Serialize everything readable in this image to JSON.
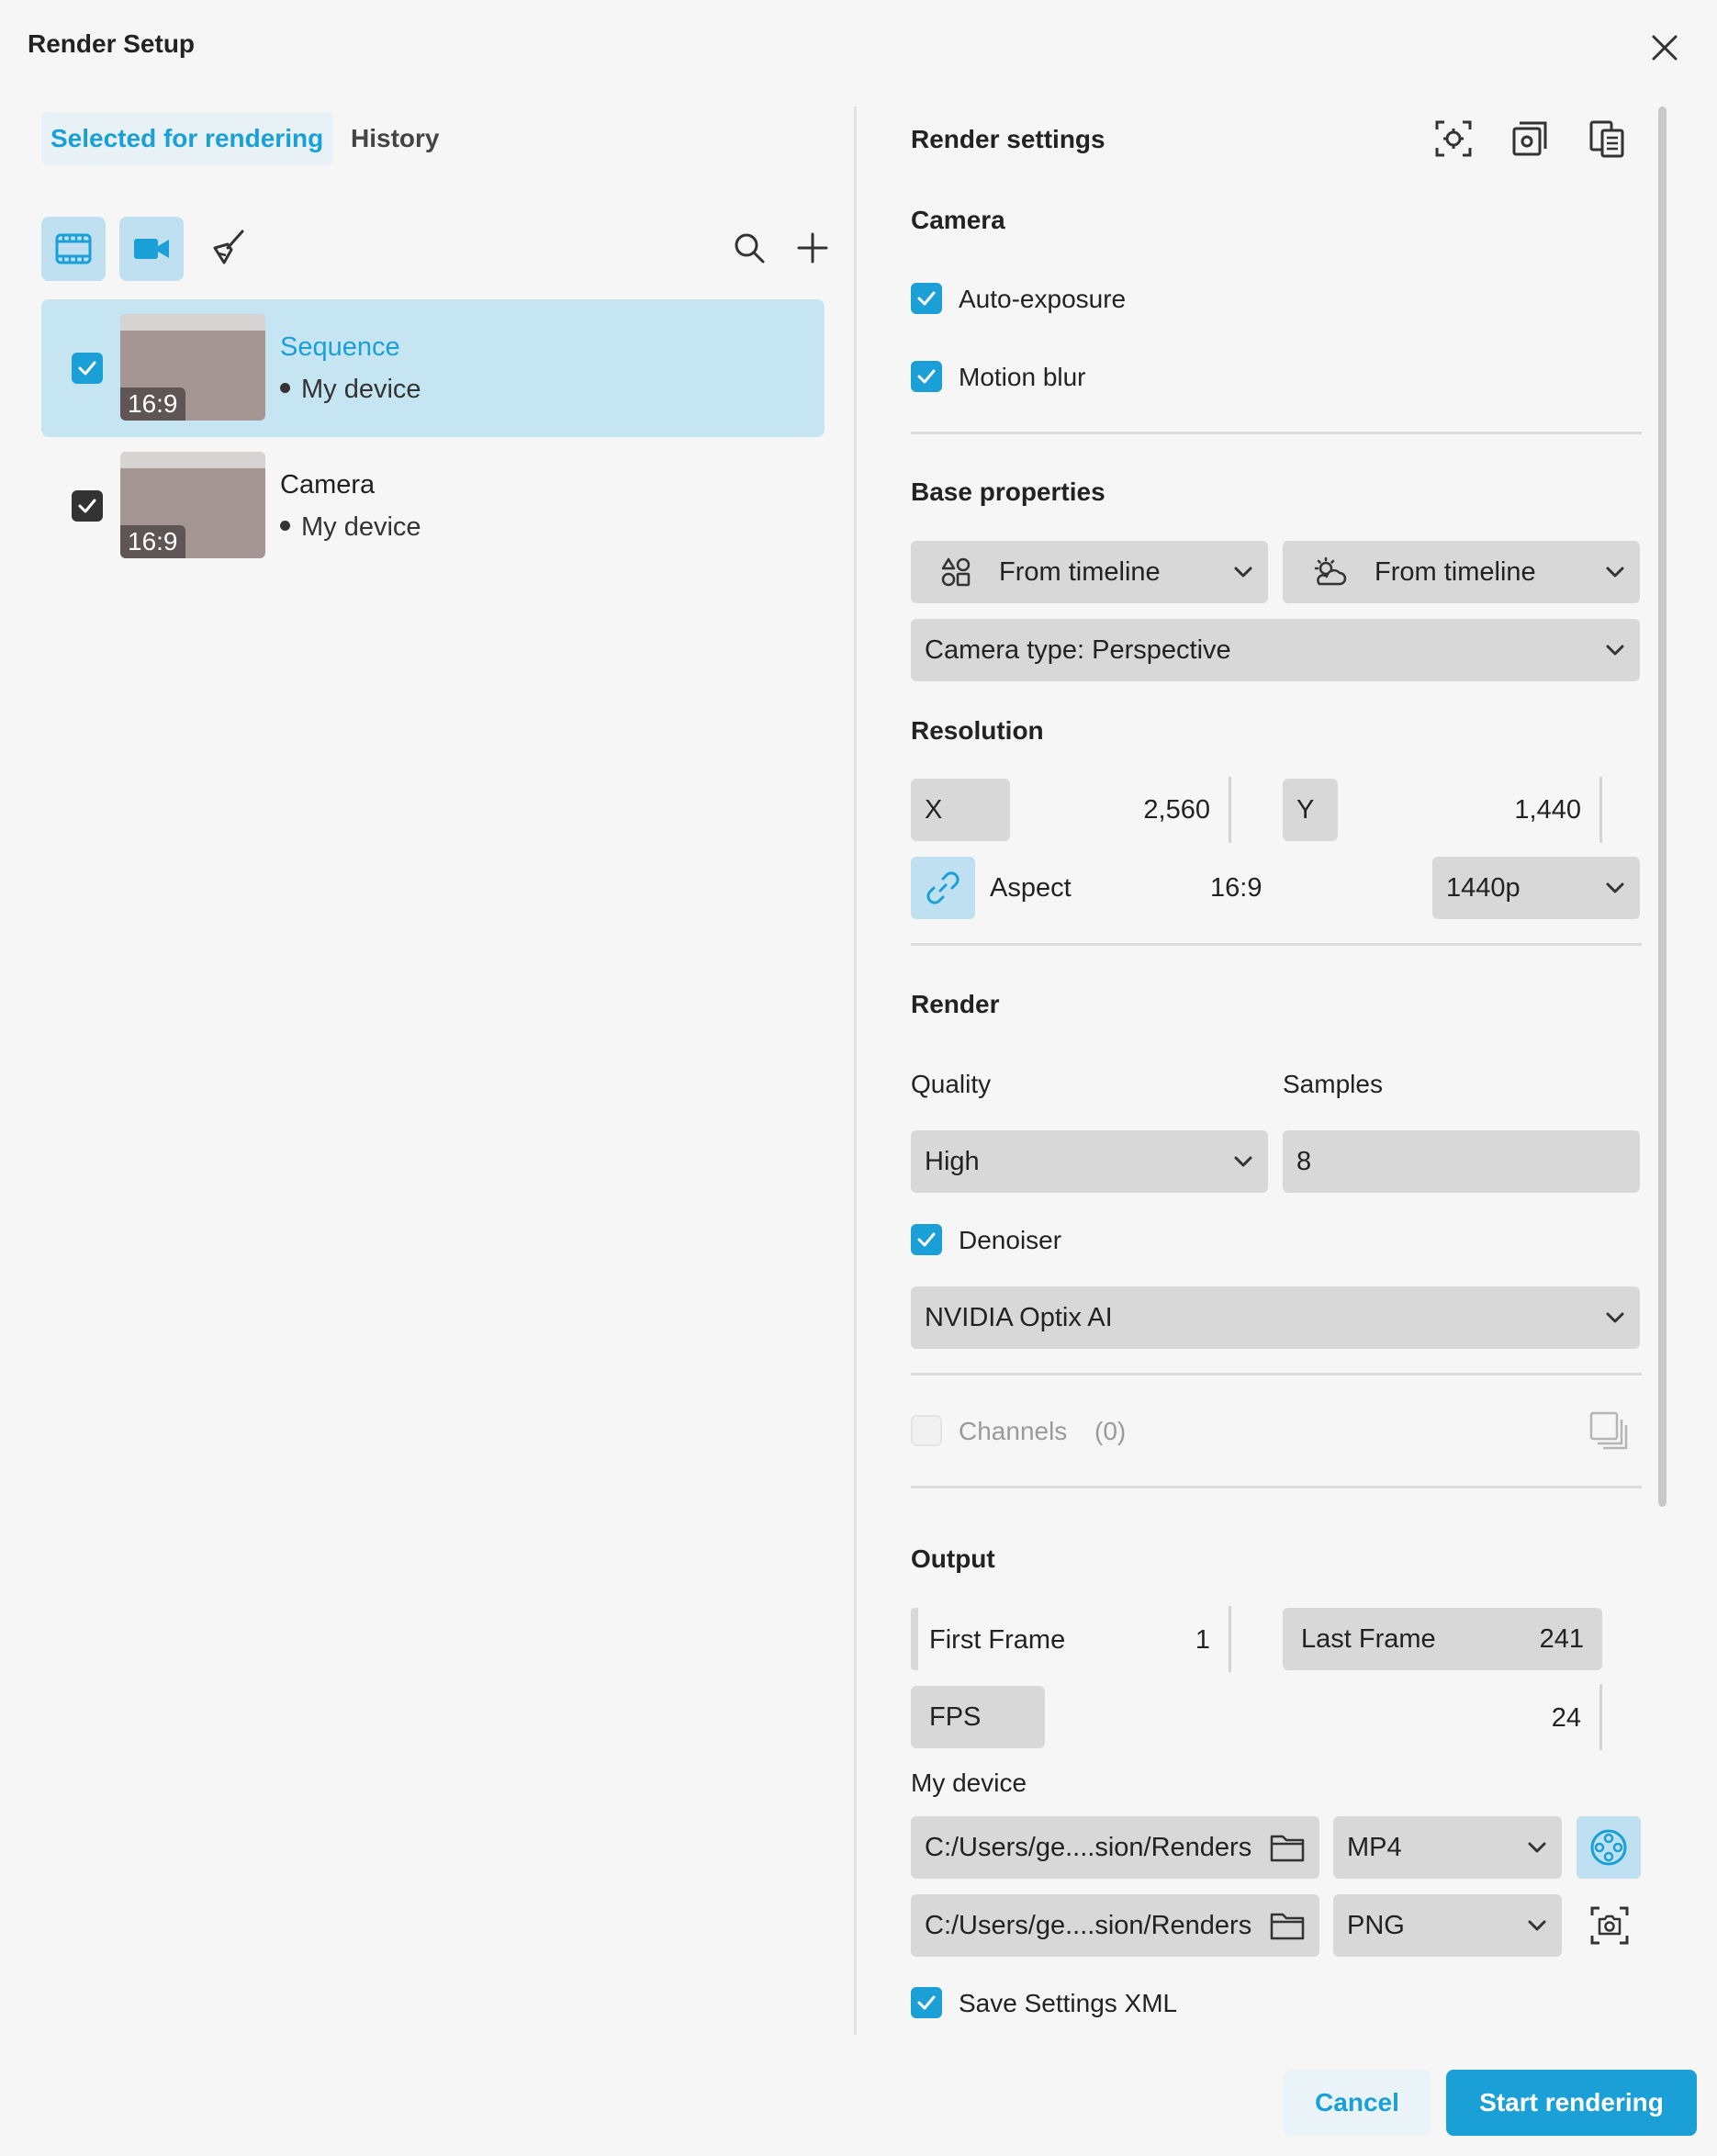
{
  "window": {
    "title": "Render Setup"
  },
  "left": {
    "tabs": [
      {
        "label": "Selected for rendering"
      },
      {
        "label": "History"
      }
    ],
    "items": [
      {
        "name": "Sequence",
        "device": "My device",
        "ratio": "16:9"
      },
      {
        "name": "Camera",
        "device": "My device",
        "ratio": "16:9"
      }
    ]
  },
  "right": {
    "heading": "Render settings",
    "camera": {
      "title": "Camera",
      "auto_exposure": "Auto-exposure",
      "motion_blur": "Motion blur"
    },
    "base": {
      "title": "Base properties",
      "env_left": "From timeline",
      "env_right": "From timeline",
      "camera_type": "Camera type: Perspective"
    },
    "resolution": {
      "title": "Resolution",
      "x_label": "X",
      "x_value": "2,560",
      "y_label": "Y",
      "y_value": "1,440",
      "aspect_label": "Aspect",
      "aspect_value": "16:9",
      "preset": "1440p"
    },
    "render": {
      "title": "Render",
      "quality_label": "Quality",
      "samples_label": "Samples",
      "quality": "High",
      "samples": "8",
      "denoiser_label": "Denoiser",
      "denoiser": "NVIDIA Optix AI",
      "channels_label": "Channels",
      "channels_count": "(0)"
    },
    "output": {
      "title": "Output",
      "first_label": "First Frame",
      "first_value": "1",
      "last_label": "Last Frame",
      "last_value": "241",
      "fps_label": "FPS",
      "fps_value": "24",
      "device_label": "My device",
      "path1": "C:/Users/ge....sion/Renders",
      "format1": "MP4",
      "path2": "C:/Users/ge....sion/Renders",
      "format2": "PNG",
      "save_xml": "Save Settings XML"
    }
  },
  "footer": {
    "cancel": "Cancel",
    "start": "Start rendering"
  },
  "colors": {
    "accent": "#1a9fd6",
    "selected_row": "#c6e5f3",
    "field": "#d8d8d8"
  }
}
